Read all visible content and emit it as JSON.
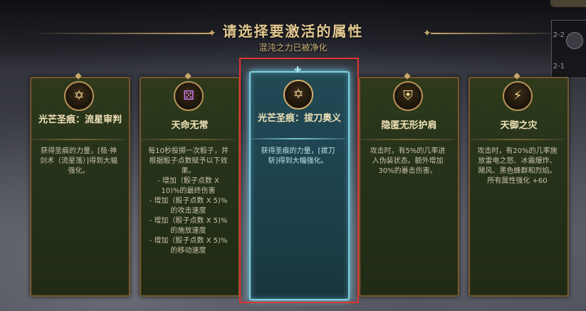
{
  "header": {
    "title": "请选择要激活的属性",
    "subtitle": "混沌之力已被净化"
  },
  "side": {
    "label_1": "2-2",
    "label_2": "2-1"
  },
  "cards": [
    {
      "name": "光芒圣痕：流星审判",
      "icon": "hexagram-star-icon",
      "description": "获得圣痕的力量，[极·神剑术（流星落）]得到大幅强化。",
      "selected": false
    },
    {
      "name": "天命无常",
      "icon": "purple-dice-icon",
      "description": "每10秒投掷一次骰子，并根据骰子点数赋予以下效果。\n- 增加（骰子点数 X 10)%的最终伤害\n- 增加（骰子点数 X 5)%的攻击速度\n- 增加（骰子点数 X 5)%的施放速度\n- 增加（骰子点数 X 5)%的移动速度",
      "selected": false
    },
    {
      "name": "光芒圣痕：拔刀奥义",
      "icon": "hexagram-star-icon",
      "description": "获得圣痕的力量，[拔刀斩]得到大幅强化。",
      "selected": true
    },
    {
      "name": "隐匿无形护肩",
      "icon": "shoulder-guard-icon",
      "description": "攻击时，有5%的几率进入伪装状态。额外增加30%的暴击伤害。",
      "selected": false
    },
    {
      "name": "天御之灾",
      "icon": "storm-shield-icon",
      "description": "攻击时，有20%的几率施放雷电之怒、冰霜爆炸、飓风、黑色蜂群和烈焰。所有属性强化 +60",
      "selected": false
    }
  ],
  "colors": {
    "title": "#e3c991",
    "card_border": "#6e5a34",
    "selected_border": "#7fd0e0",
    "highlight": "#e0342f"
  }
}
